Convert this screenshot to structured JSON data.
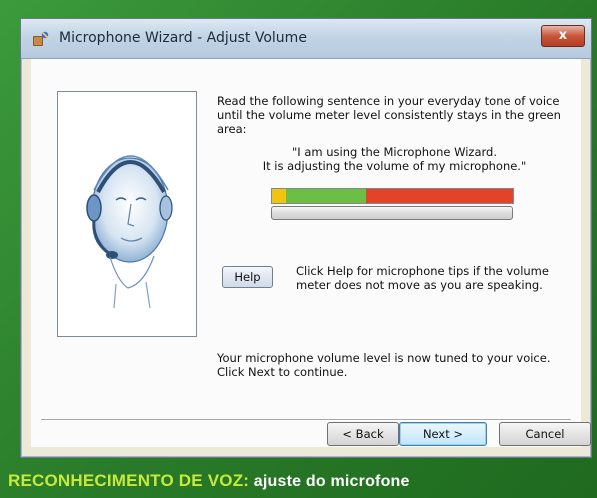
{
  "window": {
    "title": "Microphone Wizard - Adjust Volume",
    "close_label": "x"
  },
  "content": {
    "instructions": "Read the following sentence in your everyday tone of voice until the volume meter level consistently stays in the green area:",
    "quote_line1": "\"I am using the Microphone Wizard.",
    "quote_line2": "It is adjusting the volume of my microphone.\"",
    "help_button_label": "Help",
    "help_text": "Click Help for microphone tips if the volume meter does not move as you are speaking.",
    "tuned_text": "Your microphone volume level is now tuned to your voice. Click Next to continue."
  },
  "volume_meter": {
    "segments": [
      {
        "zone": "low",
        "color": "#f1c40f",
        "fraction": 0.06
      },
      {
        "zone": "good",
        "color": "#6cbf45",
        "fraction": 0.33
      },
      {
        "zone": "too-loud",
        "color": "#e4432a",
        "fraction": 0.61
      }
    ],
    "progress_fraction": 0.0
  },
  "buttons": {
    "back": "< Back",
    "next": "Next >",
    "cancel": "Cancel"
  },
  "caption": {
    "accent": "RECONHECIMENTO DE VOZ:",
    "rest": " ajuste do microfone",
    "accent_color": "#c7e93b"
  }
}
